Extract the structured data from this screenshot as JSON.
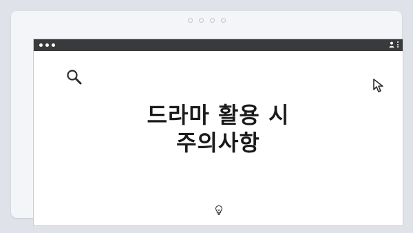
{
  "window": {
    "titlebar_controls": [
      "dot",
      "dot",
      "dot"
    ],
    "right_icons": [
      "user-icon",
      "kebab-menu-icon"
    ]
  },
  "content": {
    "headline_line1": "드라마 활용 시",
    "headline_line2": "주의사항",
    "icons": [
      "search-icon",
      "cursor-arrow-icon",
      "lightbulb-icon"
    ]
  },
  "colors": {
    "background": "#dfe2e9",
    "titlebar": "#3a3a3c",
    "content_bg": "#ffffff",
    "text": "#1a1a1a"
  }
}
